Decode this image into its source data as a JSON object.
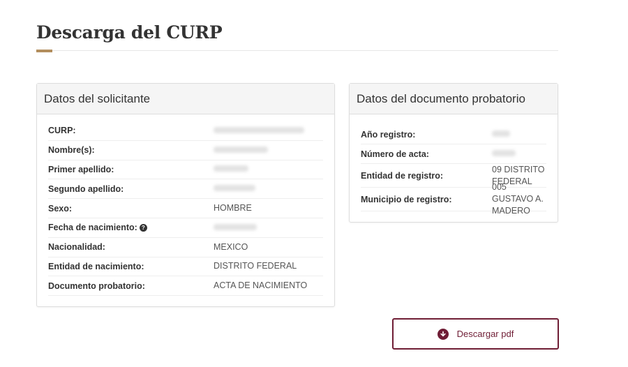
{
  "page": {
    "title": "Descarga del CURP"
  },
  "solicitante": {
    "heading": "Datos del solicitante",
    "rows": [
      {
        "label": "CURP:",
        "value": "",
        "blurred": true,
        "blur_width": 130
      },
      {
        "label": "Nombre(s):",
        "value": "",
        "blurred": true,
        "blur_width": 78
      },
      {
        "label": "Primer apellido:",
        "value": "",
        "blurred": true,
        "blur_width": 50
      },
      {
        "label": "Segundo apellido:",
        "value": "",
        "blurred": true,
        "blur_width": 60
      },
      {
        "label": "Sexo:",
        "value": "HOMBRE",
        "blurred": false
      },
      {
        "label": "Fecha de nacimiento:",
        "value": "",
        "blurred": true,
        "blur_width": 62,
        "help": true
      },
      {
        "label": "Nacionalidad:",
        "value": "MEXICO",
        "blurred": false
      },
      {
        "label": "Entidad de nacimiento:",
        "value": "DISTRITO FEDERAL",
        "blurred": false
      },
      {
        "label": "Documento probatorio:",
        "value": "ACTA DE NACIMIENTO",
        "blurred": false
      }
    ]
  },
  "documento": {
    "heading": "Datos del documento probatorio",
    "rows": [
      {
        "label": "Año registro:",
        "value": "",
        "blurred": true,
        "blur_width": 26
      },
      {
        "label": "Número de acta:",
        "value": "",
        "blurred": true,
        "blur_width": 34
      },
      {
        "label": "Entidad de registro:",
        "value": "09 DISTRITO FEDERAL",
        "blurred": false
      },
      {
        "label": "Municipio de registro:",
        "value": "005 GUSTAVO A. MADERO",
        "blurred": false
      }
    ]
  },
  "actions": {
    "download_label": "Descargar pdf"
  },
  "colors": {
    "accent": "#b38e5d",
    "primary": "#6f1d35"
  },
  "icons": {
    "help": "question-circle-icon",
    "download": "arrow-circle-down-icon"
  }
}
